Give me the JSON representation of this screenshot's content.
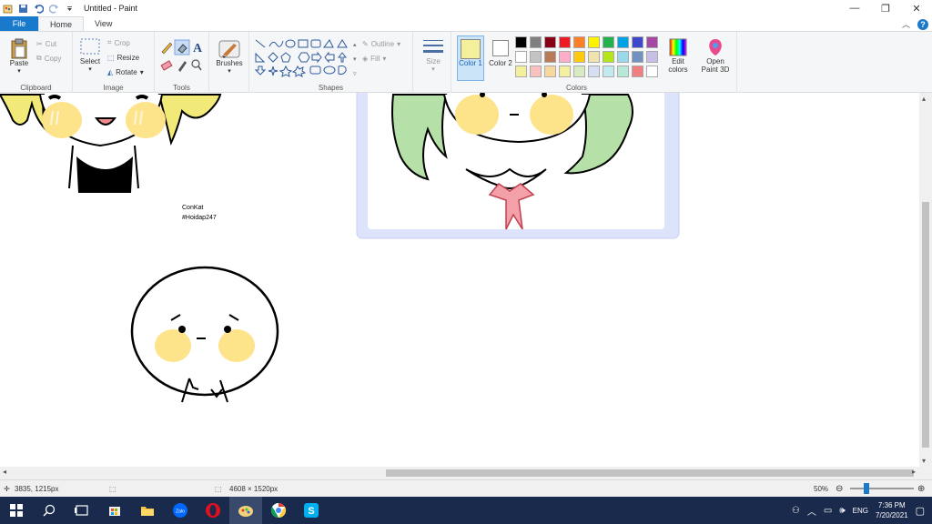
{
  "window": {
    "title": "Untitled - Paint"
  },
  "tabs": {
    "file": "File",
    "home": "Home",
    "view": "View"
  },
  "clipboard": {
    "paste": "Paste",
    "cut": "Cut",
    "copy": "Copy",
    "label": "Clipboard"
  },
  "image": {
    "select": "Select",
    "crop": "Crop",
    "resize": "Resize",
    "rotate": "Rotate",
    "label": "Image"
  },
  "tools": {
    "label": "Tools"
  },
  "brushes": {
    "label": "Brushes"
  },
  "shapes": {
    "outline": "Outline",
    "fill": "Fill",
    "label": "Shapes"
  },
  "size": {
    "label": "Size"
  },
  "colors": {
    "color1": "Color 1",
    "color2": "Color 2",
    "color1_hex": "#f4ef9a",
    "color2_hex": "#ffffff",
    "edit": "Edit colors",
    "label": "Colors",
    "row1": [
      "#000000",
      "#7f7f7f",
      "#880015",
      "#ed1c24",
      "#ff7f27",
      "#fff200",
      "#22b14c",
      "#00a2e8",
      "#3f48cc",
      "#a349a4"
    ],
    "row2": [
      "#ffffff",
      "#c3c3c3",
      "#b97a57",
      "#ffaec9",
      "#ffc90e",
      "#efe4b0",
      "#b5e61d",
      "#99d9ea",
      "#7092be",
      "#c8bfe7"
    ],
    "row3": [
      "#f4ef9a",
      "#f9c0c0",
      "#f7d9a0",
      "#f5f0a0",
      "#d8eac0",
      "#d6def4",
      "#c0eaf0",
      "#b8e8d8",
      "#f08080",
      "#ffffff"
    ]
  },
  "paint3d": {
    "label": "Open Paint 3D"
  },
  "canvas": {
    "credit1": "ConKat",
    "credit2": "#Hoidap247"
  },
  "status": {
    "cursor": "3835, 1215px",
    "dimensions": "4608 × 1520px",
    "zoom": "50%"
  },
  "tray": {
    "lang": "ENG",
    "time": "7:36 PM",
    "date": "7/20/2021"
  }
}
